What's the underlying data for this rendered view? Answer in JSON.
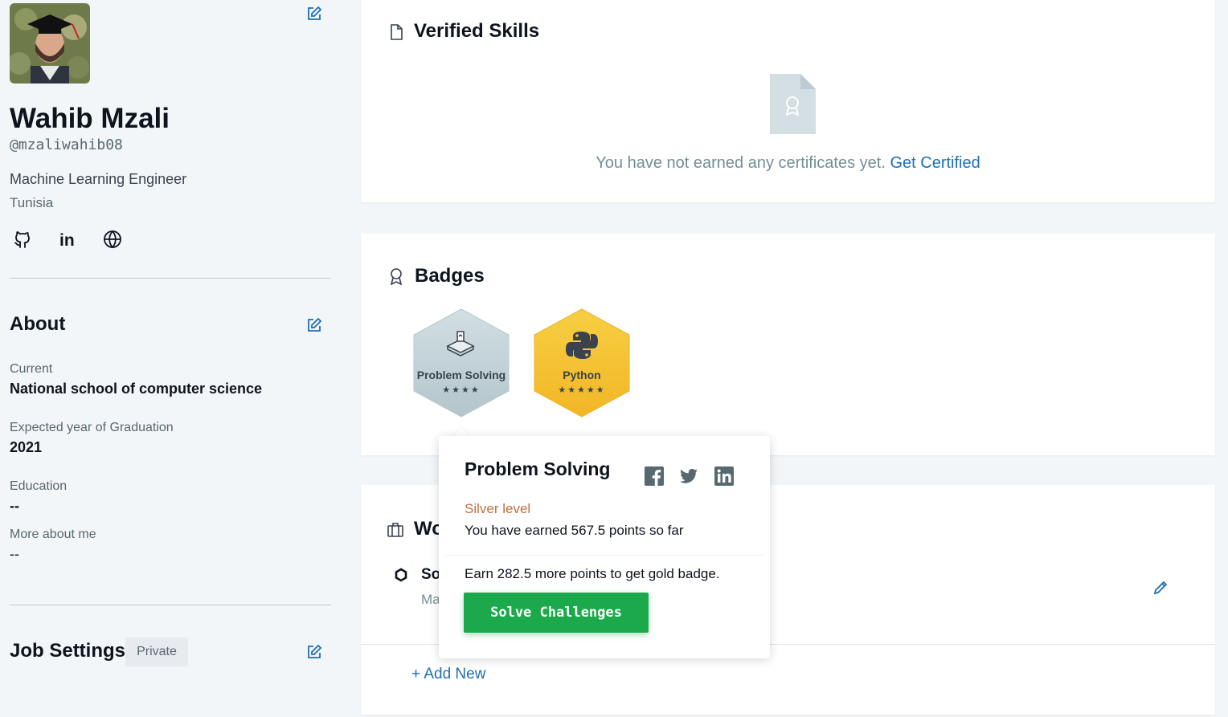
{
  "profile": {
    "name": "Wahib Mzali",
    "handle": "@mzaliwahib08",
    "title": "Machine Learning Engineer",
    "country": "Tunisia"
  },
  "about": {
    "heading": "About",
    "fields": [
      {
        "label": "Current",
        "value": "National school of computer science"
      },
      {
        "label": "Expected year of Graduation",
        "value": "2021"
      },
      {
        "label": "Education",
        "value": "--"
      },
      {
        "label": "More about me",
        "value": "--"
      }
    ]
  },
  "job_settings": {
    "heading": "Job Settings",
    "visibility": "Private"
  },
  "verified_skills": {
    "heading": "Verified Skills",
    "empty_text": "You have not earned any certificates yet.",
    "cta": "Get Certified"
  },
  "badges": {
    "heading": "Badges",
    "items": [
      {
        "name": "Problem Solving",
        "stars": "★★★★",
        "star_count": 4,
        "color": "#c4d3d9"
      },
      {
        "name": "Python",
        "stars": "★★★★★",
        "star_count": 5,
        "color": "#f5c537"
      }
    ]
  },
  "work": {
    "heading_partial": "Wo",
    "item_title_partial": "So",
    "item_sub_partial": "Ma",
    "add_new": "+ Add New"
  },
  "popover": {
    "title": "Problem Solving",
    "level": "Silver level",
    "earned": "You have earned 567.5 points so far",
    "more": "Earn 282.5 more points to get gold badge.",
    "button": "Solve Challenges"
  },
  "colors": {
    "accent_blue": "#1f6fb2",
    "success_green": "#1ba94c",
    "silver_level": "#c0703d"
  }
}
